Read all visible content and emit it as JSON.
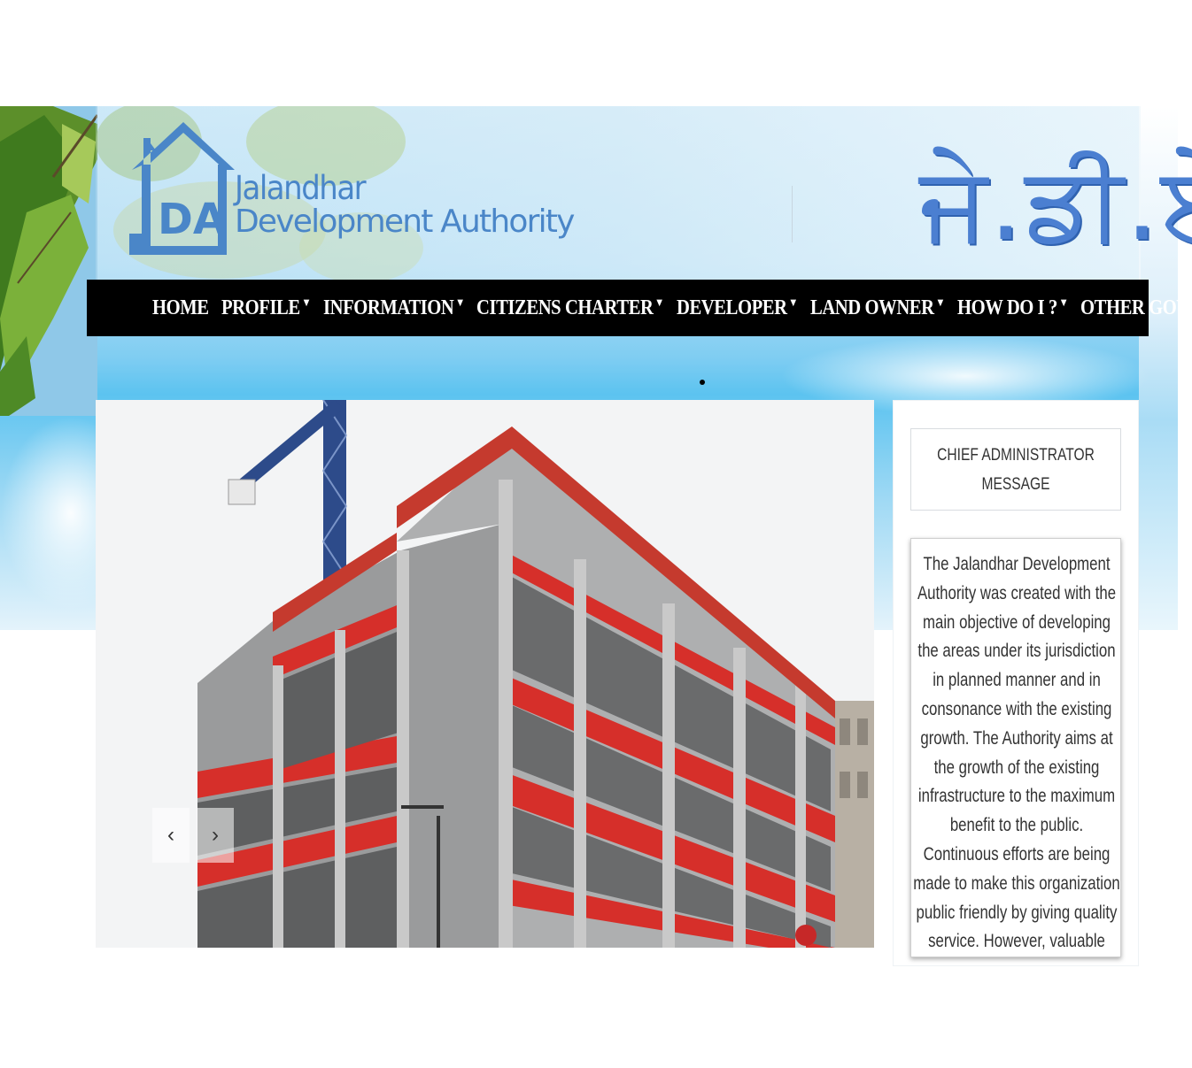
{
  "header": {
    "org_name_line1": "Jalandhar",
    "org_name_line2": "Development Authority",
    "punjabi_name": "ਜੇ.ਡੀ.ਏ.",
    "logo_letters": "DA"
  },
  "nav": {
    "items": [
      {
        "label": "HOME",
        "has_dropdown": false
      },
      {
        "label": "PROFILE",
        "has_dropdown": true
      },
      {
        "label": "INFORMATION",
        "has_dropdown": true
      },
      {
        "label": "CITIZENS CHARTER",
        "has_dropdown": true
      },
      {
        "label": "DEVELOPER",
        "has_dropdown": true
      },
      {
        "label": "LAND OWNER",
        "has_dropdown": true
      },
      {
        "label": "HOW DO I ?",
        "has_dropdown": true
      },
      {
        "label": "OTHER GOVT LINKS",
        "has_dropdown": true
      }
    ],
    "caret": "▼"
  },
  "slider": {
    "prev_label": "‹",
    "next_label": "›",
    "image": "building-under-construction"
  },
  "sidebar": {
    "message_button": "CHIEF ADMINISTRATOR MESSAGE",
    "message_text": "The Jalandhar Development Authority was created with the main objective of developing the areas under its jurisdiction in planned manner and in consonance with the existing growth. The Authority aims at the growth of the existing infrastructure to the maximum benefit to the public. Continuous efforts are being made to make this organization public friendly by giving quality service. However, valuable suggestions"
  },
  "colors": {
    "nav_bg": "#000000",
    "nav_text": "#ffffff",
    "logo_blue": "#4a86c8",
    "punjabi_blue": "#4b7fd1"
  }
}
